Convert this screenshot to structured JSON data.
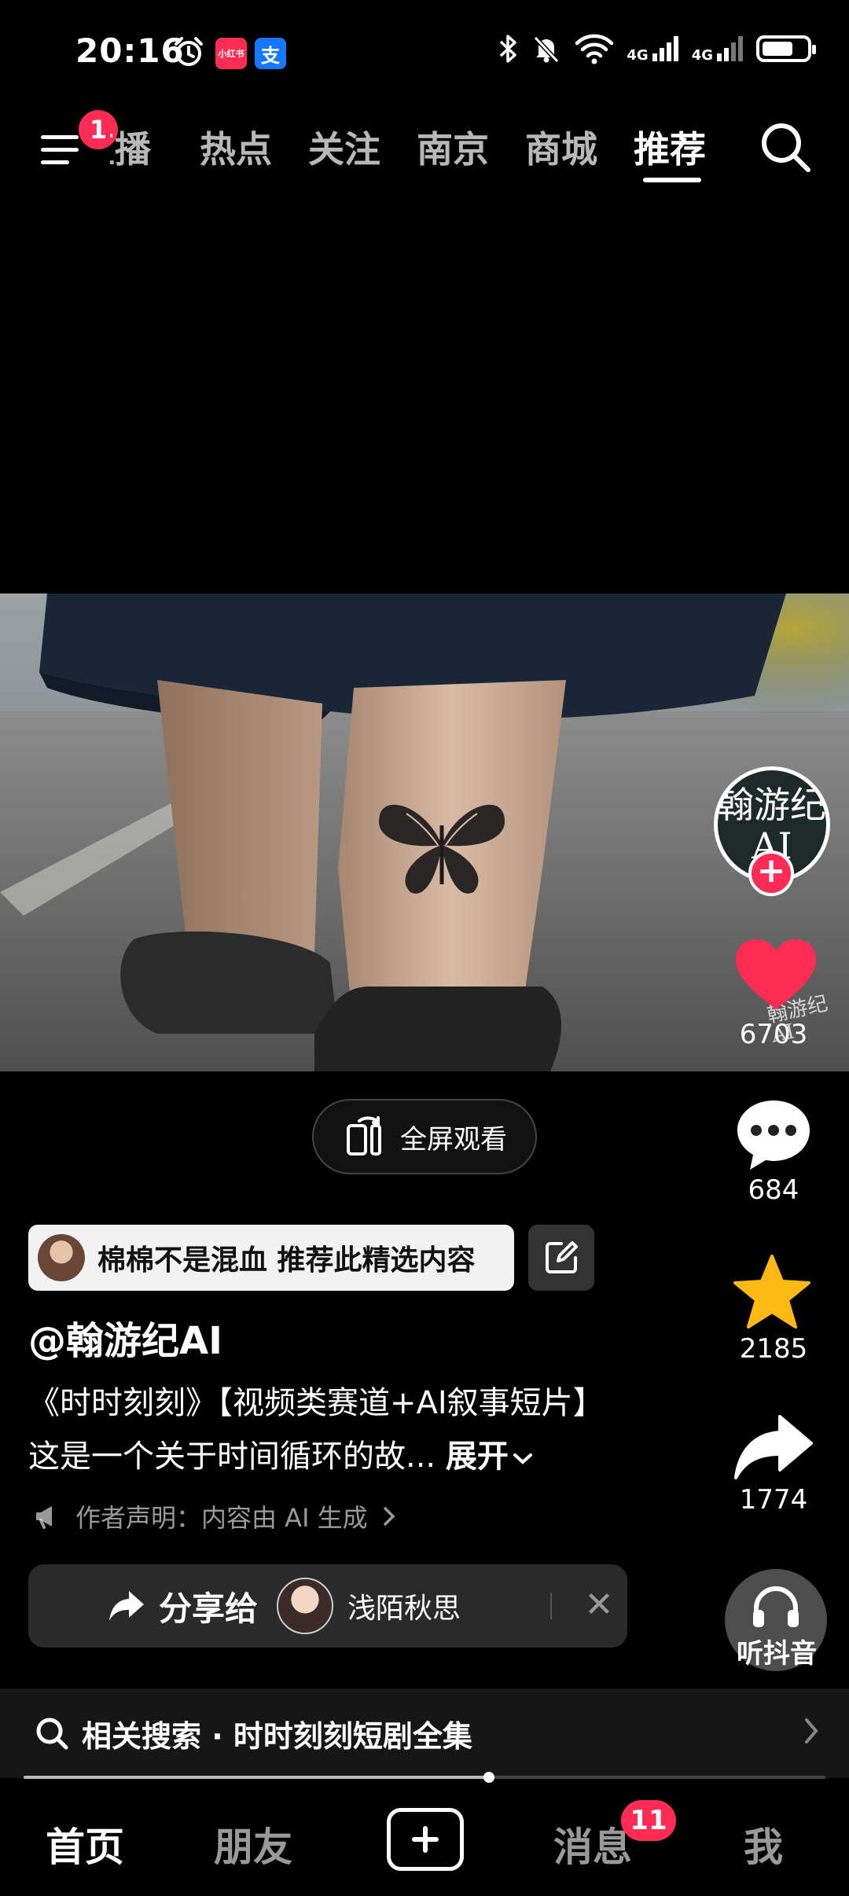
{
  "status": {
    "time": "20:16",
    "app_icons": [
      "小红书",
      "支"
    ],
    "network_1": "4G",
    "network_2": "4G",
    "battery_level": 0.7
  },
  "top_nav": {
    "menu_badge": "1",
    "tabs": [
      "直播",
      "热点",
      "关注",
      "南京",
      "商城",
      "推荐"
    ],
    "active_tab": "推荐"
  },
  "creator": {
    "avatar_text": "翰游纪AI"
  },
  "watermark": "翰游纪AI",
  "actions": {
    "like_count": "6703",
    "comment_count": "684",
    "favorite_count": "2185",
    "share_count": "1774"
  },
  "fullscreen_label": "全屏观看",
  "recommend": {
    "text": "棉棉不是混血 推荐此精选内容"
  },
  "author": "@翰游纪AI",
  "description": {
    "line1": "《时时刻刻》【视频类赛道+AI叙事短片】",
    "line2": "这是一个关于时间循环的故...",
    "expand_label": "展开"
  },
  "notice": "作者声明：内容由 AI 生成",
  "share": {
    "label": "分享给",
    "username": "浅陌秋思"
  },
  "listen_label": "听抖音",
  "related_search": "相关搜索 · 时时刻刻短剧全集",
  "progress": 0.58,
  "bottom_nav": {
    "items": [
      "首页",
      "朋友",
      "消息",
      "我"
    ],
    "active": "首页",
    "message_badge": "11"
  },
  "colors": {
    "accent": "#fe2c55",
    "favorite": "#fdb813"
  }
}
